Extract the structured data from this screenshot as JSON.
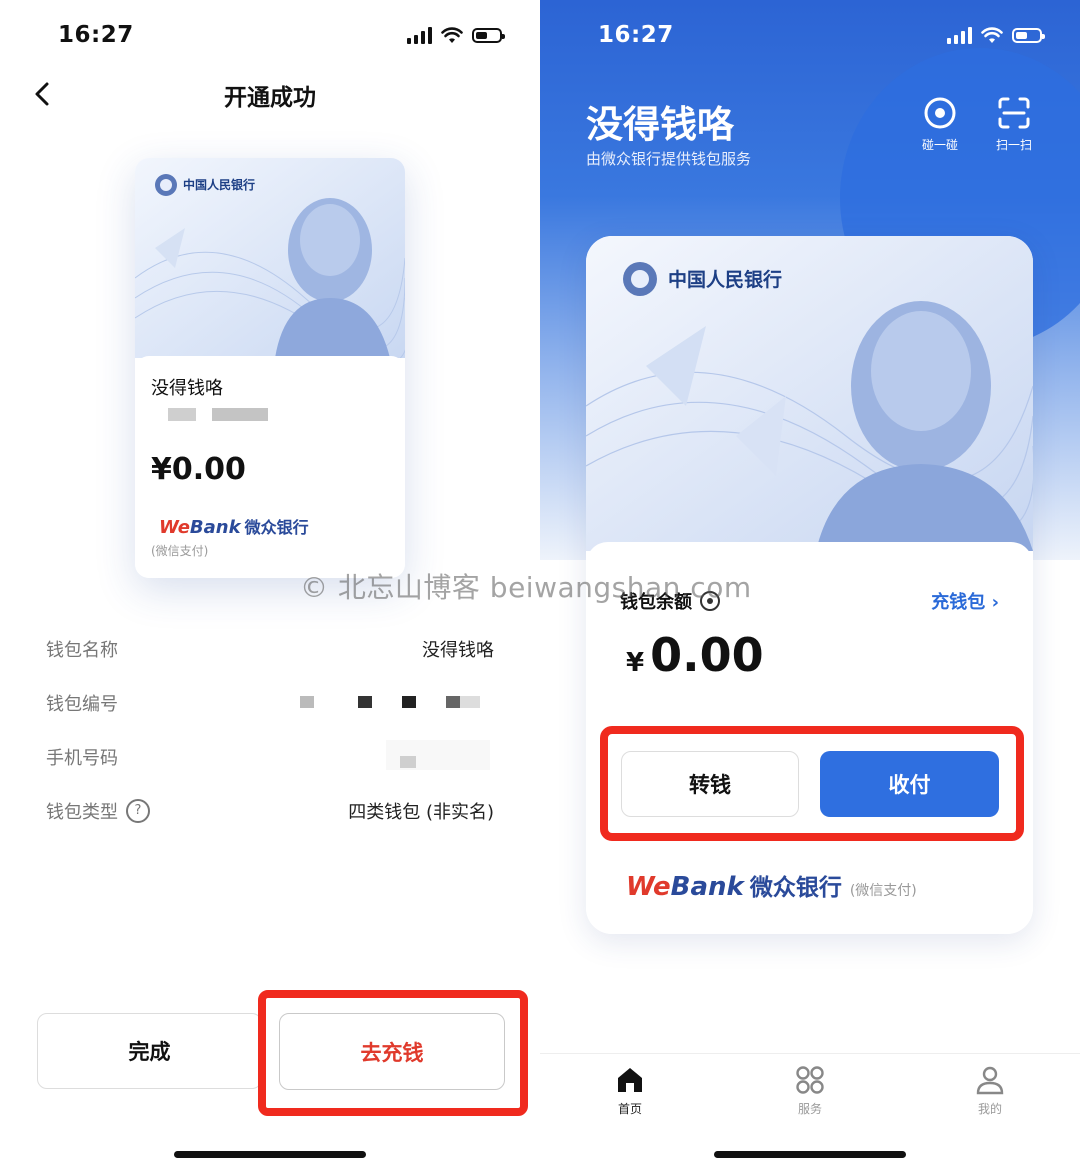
{
  "left": {
    "status": {
      "time": "16:27"
    },
    "nav": {
      "title": "开通成功"
    },
    "card": {
      "bank_name": "中国人民银行",
      "wallet_name": "没得钱咯",
      "balance": "¥0.00",
      "webank_we": "We",
      "webank_bank": "Bank",
      "webank_cn": "微众银行",
      "wechat_pay": "(微信支付)"
    },
    "rows": [
      {
        "label": "钱包名称",
        "value": "没得钱咯"
      },
      {
        "label": "钱包编号",
        "value": ""
      },
      {
        "label": "手机号码",
        "value": ""
      },
      {
        "label": "钱包类型",
        "value": "四类钱包 (非实名)"
      }
    ],
    "buttons": {
      "done": "完成",
      "topup": "去充钱"
    }
  },
  "right": {
    "status": {
      "time": "16:27"
    },
    "hero": {
      "title": "没得钱咯",
      "subtitle": "由微众银行提供钱包服务",
      "tap_label": "碰一碰",
      "scan_label": "扫一扫"
    },
    "card": {
      "bank_name": "中国人民银行",
      "balance_label": "钱包余额",
      "topup_link": "充钱包",
      "currency": "¥",
      "balance": "0.00",
      "transfer": "转钱",
      "collect_pay": "收付",
      "webank_we": "We",
      "webank_bank": "Bank",
      "webank_cn": "微众银行",
      "wechat_pay": "(微信支付)"
    },
    "tabs": [
      {
        "label": "首页",
        "icon": "home-icon",
        "active": true
      },
      {
        "label": "服务",
        "icon": "grid-icon",
        "active": false
      },
      {
        "label": "我的",
        "icon": "user-icon",
        "active": false
      }
    ]
  },
  "watermark": "© 北忘山博客 beiwangshan.com",
  "colors": {
    "accent_blue": "#2f6fe0",
    "highlight_red": "#f02a1e",
    "webank_red": "#e03a2c"
  }
}
